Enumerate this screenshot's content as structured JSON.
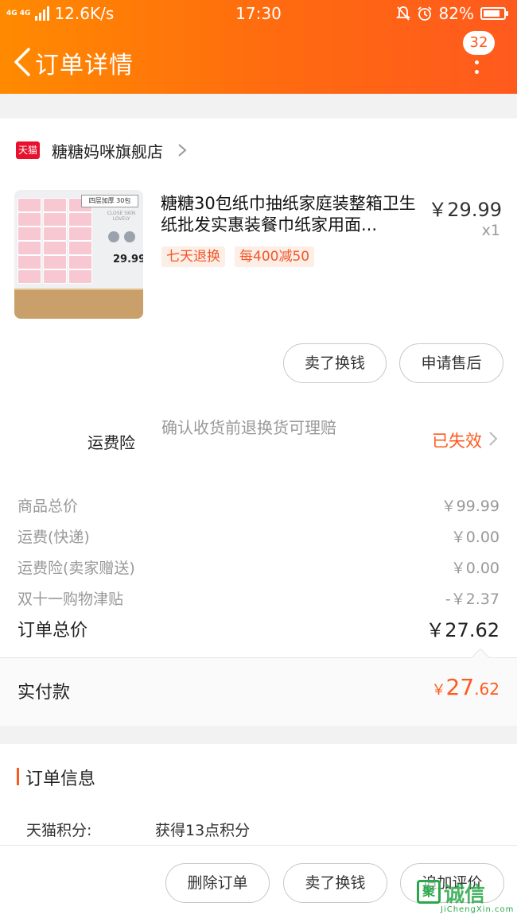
{
  "status_bar": {
    "network": "4G 4G",
    "speed": "12.6K/s",
    "time": "17:30",
    "battery": "82%",
    "battery_level": 0.82
  },
  "header": {
    "title": "订单详情",
    "badge_count": "32"
  },
  "shop": {
    "platform_badge": "天猫",
    "name": "糖糖妈咪旗舰店"
  },
  "product": {
    "image_label": "四层加厚 30包",
    "image_sub": "CLOSE SKIN LOVELY",
    "image_price": "29.99",
    "title": "糖糖30包纸巾抽纸家庭装整箱卫生纸批发实惠装餐巾纸家用面...",
    "price": "￥29.99",
    "quantity": "x1",
    "tags": [
      "七天退换",
      "每400减50"
    ]
  },
  "item_actions": {
    "sell": "卖了换钱",
    "after_sale": "申请售后"
  },
  "insurance": {
    "label": "运费险",
    "description": "确认收货前退换货可理赔",
    "status": "已失效"
  },
  "fees": [
    {
      "label": "商品总价",
      "value": "￥99.99"
    },
    {
      "label": "运费(快递)",
      "value": "￥0.00"
    },
    {
      "label": "运费险(卖家赠送)",
      "value": "￥0.00"
    },
    {
      "label": "双十一购物津贴",
      "value": "-￥2.37"
    }
  ],
  "order_total": {
    "label": "订单总价",
    "value": "￥27.62"
  },
  "paid": {
    "label": "实付款",
    "currency": "￥",
    "integer": "27",
    "decimal": ".62"
  },
  "order_info": {
    "title": "订单信息",
    "rows": [
      {
        "label": "天猫积分:",
        "value": "获得13点积分"
      }
    ]
  },
  "bottom_actions": {
    "delete": "删除订单",
    "sell": "卖了换钱",
    "review": "追加评价"
  },
  "watermark": {
    "logo": "聚",
    "text": "诚信",
    "sub": "JiChengXin.com"
  },
  "colors": {
    "accent": "#ff5a1e",
    "header_start": "#ff8a00",
    "header_end": "#ff5a1e",
    "tmall_red": "#e8102c",
    "tag_bg": "#fdeee6"
  }
}
